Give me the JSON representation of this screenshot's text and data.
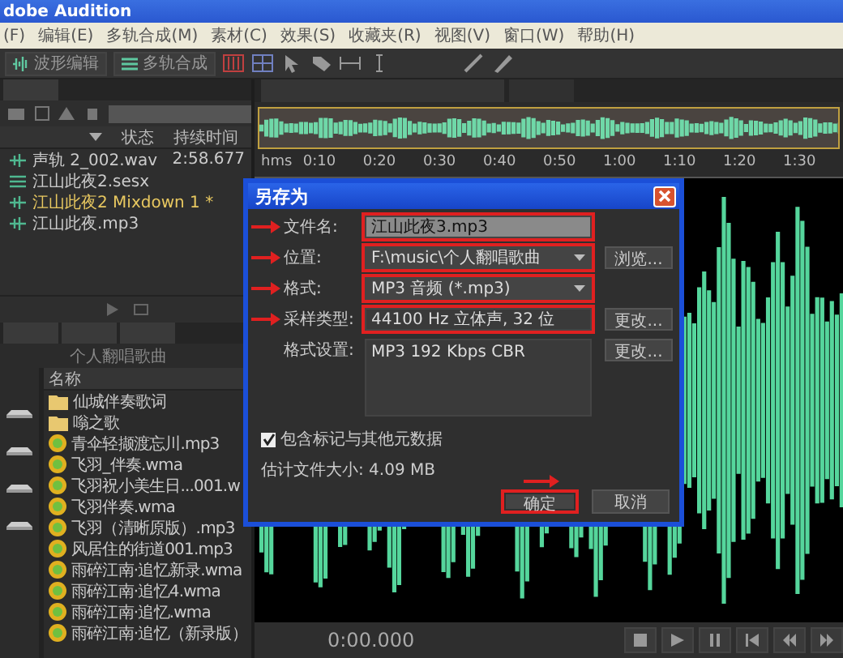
{
  "window": {
    "title": "dobe Audition"
  },
  "menu": [
    "(F)",
    "编辑(E)",
    "多轨合成(M)",
    "素材(C)",
    "效果(S)",
    "收藏夹(R)",
    "视图(V)",
    "窗口(W)",
    "帮助(H)"
  ],
  "toolbar": [
    {
      "label": "波形编辑",
      "kind": "waveform"
    },
    {
      "label": "多轨合成",
      "kind": "multitrack"
    }
  ],
  "files_panel": {
    "columns": [
      "状态",
      "持续时间"
    ],
    "rows": [
      {
        "name": "声轨 2_002.wav",
        "kind": "audio",
        "duration": "2:58.677",
        "selected": false
      },
      {
        "name": "江山此夜2.sesx",
        "kind": "session",
        "selected": false
      },
      {
        "name": "江山此夜2 Mixdown 1 *",
        "kind": "audio",
        "selected": true
      },
      {
        "name": "江山此夜.mp3",
        "kind": "audio",
        "selected": false
      }
    ]
  },
  "media_browser": {
    "location": "个人翻唱歌曲",
    "column": "名称",
    "items": [
      {
        "name": "仙城伴奏歌词",
        "kind": "folder"
      },
      {
        "name": "嗡之歌",
        "kind": "folder"
      },
      {
        "name": "青伞轻撷渡忘川.mp3",
        "kind": "file"
      },
      {
        "name": "飞羽_伴奏.wma",
        "kind": "file"
      },
      {
        "name": "飞羽祝小美生日...001.w",
        "kind": "file"
      },
      {
        "name": "飞羽伴奏.wma",
        "kind": "file"
      },
      {
        "name": "飞羽（清晰原版）.mp3",
        "kind": "file"
      },
      {
        "name": "风居住的街道001.mp3",
        "kind": "file"
      },
      {
        "name": "雨碎江南·追忆新录.wma",
        "kind": "file"
      },
      {
        "name": "雨碎江南·追忆4.wma",
        "kind": "file"
      },
      {
        "name": "雨碎江南·追忆.wma",
        "kind": "file"
      },
      {
        "name": "雨碎江南·追忆（新录版）",
        "kind": "file"
      }
    ]
  },
  "editor": {
    "ruler": [
      "hms",
      "0:10",
      "0:20",
      "0:30",
      "0:40",
      "0:50",
      "1:00",
      "1:10",
      "1:20",
      "1:30"
    ],
    "time": "0:00.000"
  },
  "dialog": {
    "title": "另存为",
    "rows": [
      {
        "label": "文件名:",
        "value": "江山此夜3.mp3",
        "kind": "text",
        "highlighted": true
      },
      {
        "label": "位置:",
        "value": "F:\\music\\个人翻唱歌曲",
        "kind": "dropdown",
        "button": "浏览...",
        "highlighted": true
      },
      {
        "label": "格式:",
        "value": "MP3 音频 (*.mp3)",
        "kind": "dropdown",
        "highlighted": true
      },
      {
        "label": "采样类型:",
        "value": "44100 Hz 立体声, 32 位",
        "kind": "readout",
        "button": "更改...",
        "highlighted": true
      },
      {
        "label": "格式设置:",
        "value": "MP3 192 Kbps CBR",
        "kind": "area",
        "button": "更改...",
        "highlighted": false
      }
    ],
    "checkbox": {
      "label": "包含标记与其他元数据",
      "checked": true
    },
    "size": "估计文件大小: 4.09 MB",
    "buttons": [
      {
        "label": "确定",
        "highlighted": true
      },
      {
        "label": "取消",
        "highlighted": false
      }
    ]
  }
}
